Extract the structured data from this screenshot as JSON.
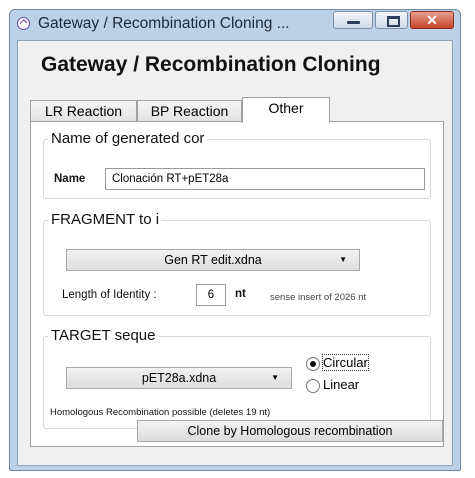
{
  "window": {
    "title": "Gateway / Recombination Cloning ..."
  },
  "heading": "Gateway / Recombination Cloning",
  "tabs": [
    {
      "label": "LR Reaction"
    },
    {
      "label": "BP Reaction"
    },
    {
      "label": "Other",
      "active": true
    }
  ],
  "name_group": {
    "legend": "Name of generated cor",
    "label": "Name",
    "value": "Clonación RT+pET28a"
  },
  "fragment_group": {
    "legend": "FRAGMENT to i",
    "file": "Gen RT edit.xdna",
    "identity_label": "Length of Identity :",
    "identity_value": "6",
    "unit": "nt",
    "info": "sense insert of 2026 nt"
  },
  "target_group": {
    "legend": "TARGET seque",
    "file": "pET28a.xdna",
    "radio_circular": "Circular",
    "radio_linear": "Linear",
    "selected": "Circular",
    "status": "Homologous Recombination possible (deletes 19 nt)"
  },
  "clone_button": "Clone by Homologous recombination",
  "colors": {
    "titlebar": "#bcd0e6",
    "close_button": "#c4432c",
    "panel": "#ffffff"
  }
}
